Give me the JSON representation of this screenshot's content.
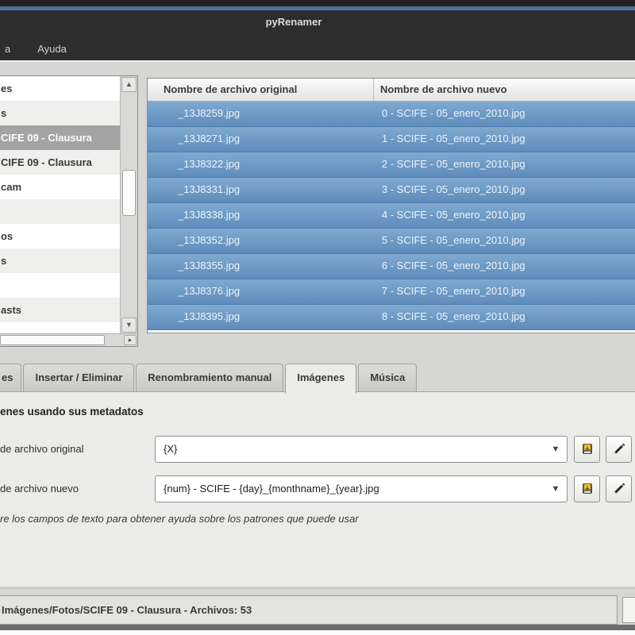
{
  "window": {
    "title": "pyRenamer"
  },
  "menubar": {
    "items": [
      {
        "label": "a"
      },
      {
        "label": "Ayuda"
      }
    ]
  },
  "tree": {
    "items": [
      {
        "label": "es",
        "selected": false
      },
      {
        "label": "s",
        "selected": false
      },
      {
        "label": "CIFE 09 - Clausura",
        "selected": true
      },
      {
        "label": "CIFE 09 - Clausura",
        "selected": false
      },
      {
        "label": "cam",
        "selected": false
      },
      {
        "label": "",
        "selected": false
      },
      {
        "label": "os",
        "selected": false
      },
      {
        "label": "s",
        "selected": false
      },
      {
        "label": "",
        "selected": false
      },
      {
        "label": "asts",
        "selected": false
      }
    ]
  },
  "file_table": {
    "columns": [
      "Nombre de archivo original",
      "Nombre de archivo nuevo"
    ],
    "rows": [
      {
        "original": "_13J8259.jpg",
        "nuevo": "0 - SCIFE - 05_enero_2010.jpg"
      },
      {
        "original": "_13J8271.jpg",
        "nuevo": "1 - SCIFE - 05_enero_2010.jpg"
      },
      {
        "original": "_13J8322.jpg",
        "nuevo": "2 - SCIFE - 05_enero_2010.jpg"
      },
      {
        "original": "_13J8331.jpg",
        "nuevo": "3 - SCIFE - 05_enero_2010.jpg"
      },
      {
        "original": "_13J8338.jpg",
        "nuevo": "4 - SCIFE - 05_enero_2010.jpg"
      },
      {
        "original": "_13J8352.jpg",
        "nuevo": "5 - SCIFE - 05_enero_2010.jpg"
      },
      {
        "original": "_13J8355.jpg",
        "nuevo": "6 - SCIFE - 05_enero_2010.jpg"
      },
      {
        "original": "_13J8376.jpg",
        "nuevo": "7 - SCIFE - 05_enero_2010.jpg"
      },
      {
        "original": "_13J8395.jpg",
        "nuevo": "8 - SCIFE - 05_enero_2010.jpg"
      }
    ]
  },
  "tabs": {
    "items": [
      {
        "label": "es"
      },
      {
        "label": "Insertar / Eliminar"
      },
      {
        "label": "Renombramiento manual"
      },
      {
        "label": "Imágenes"
      },
      {
        "label": "Música"
      }
    ],
    "active": "Imágenes"
  },
  "panel": {
    "heading": "enes usando sus metadatos",
    "fields": [
      {
        "label": "de archivo original",
        "value": "{X}"
      },
      {
        "label": "de archivo nuevo",
        "value": "{num} - SCIFE - {day}_{monthname}_{year}.jpg"
      }
    ],
    "hint": "re los campos de texto para obtener ayuda sobre los patrones que puede usar"
  },
  "statusbar": {
    "text": "Imágenes/Fotos/SCIFE 09 - Clausura - Archivos: 53"
  },
  "colors": {
    "titlebar_bg": "#2d2d2d",
    "titlebar_accent": "#4c719a",
    "selection_blue_top": "#7fa9d0",
    "selection_blue_bottom": "#5e8cba",
    "tree_selection_gray": "#a4a4a4",
    "window_bg": "#d6d6d4",
    "panel_bg": "#ebebe9"
  }
}
